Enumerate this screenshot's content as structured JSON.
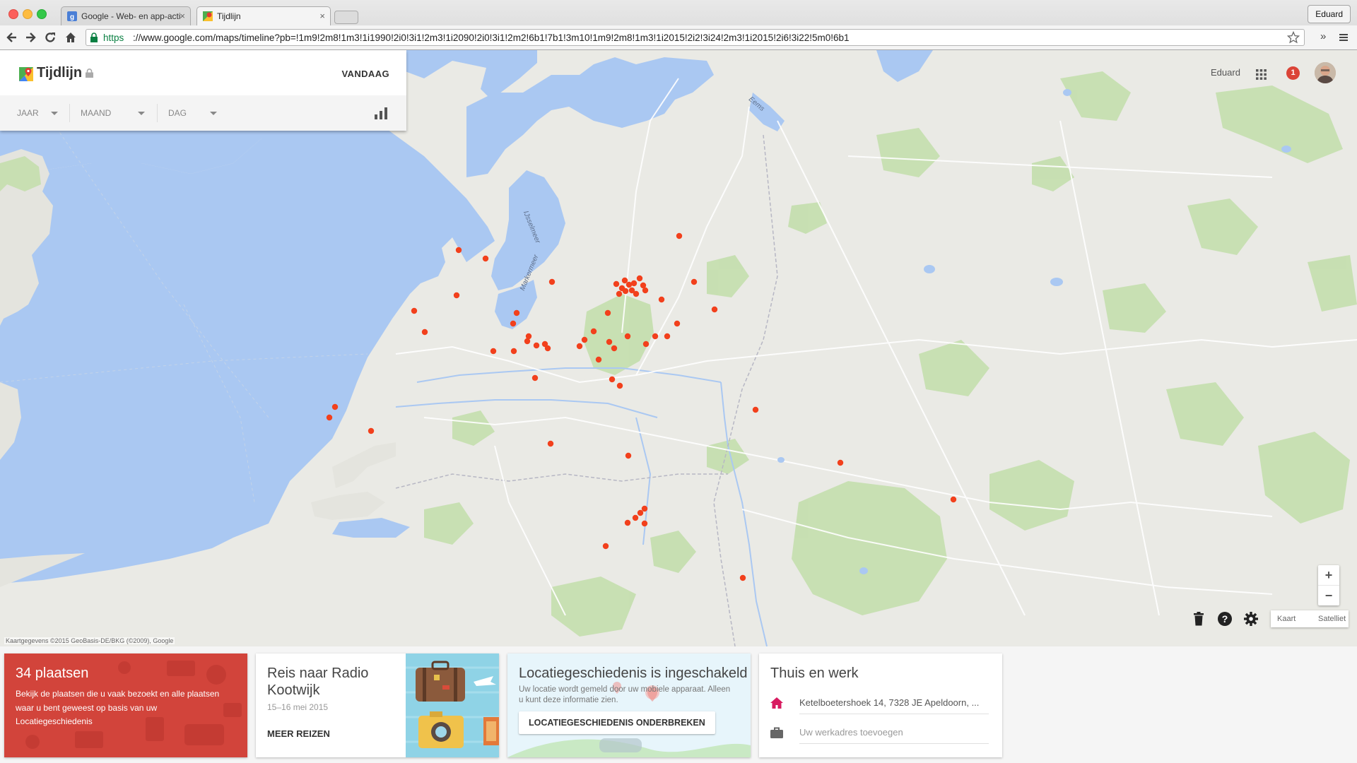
{
  "browser": {
    "tabs": [
      {
        "title": "Google - Web- en app-acti",
        "active": false
      },
      {
        "title": "Tijdlijn",
        "active": true
      }
    ],
    "profile_button": "Eduard",
    "url_scheme": "https",
    "url_rest": "://www.google.com/maps/timeline?pb=!1m9!2m8!1m3!1i1990!2i0!3i1!2m3!1i2090!2i0!3i1!2m2!6b1!7b1!3m10!1m9!2m8!1m3!1i2015!2i2!3i24!2m3!1i2015!2i6!3i22!5m0!6b1"
  },
  "timeline_panel": {
    "title": "Tijdlijn",
    "today_button": "VANDAAG",
    "filters": [
      "JAAR",
      "MAAND",
      "DAG"
    ]
  },
  "account": {
    "name": "Eduard",
    "notifications": "1"
  },
  "map": {
    "labels": {
      "ijsselmeer": "IJsselmeer",
      "markermeer": "Markermeer",
      "eems": "Eems"
    },
    "attribution": "Kaartgegevens ©2015 GeoBasis-DE/BKG (©2009), Google",
    "controls": {
      "zoom_in": "+",
      "zoom_out": "−",
      "map_type": "Kaart",
      "satellite_type": "Satelliet"
    },
    "visit_marker_color": "#f2401c"
  },
  "cards": {
    "places": {
      "title": "34 plaatsen",
      "description": "Bekijk de plaatsen die u vaak bezoekt en alle plaatsen waar u bent geweest op basis van uw Locatiegeschiedenis"
    },
    "trip": {
      "title": "Reis naar Radio Kootwijk",
      "date": "15–16 mei 2015",
      "action": "MEER REIZEN"
    },
    "location_history": {
      "title": "Locatiegeschiedenis is ingeschakeld",
      "description": "Uw locatie wordt gemeld door uw mobiele apparaat. Alleen u kunt deze informatie zien.",
      "action": "LOCATIEGESCHIEDENIS ONDERBREKEN"
    },
    "home_work": {
      "title": "Thuis en werk",
      "home_address": "Ketelboetershoek 14, 7328 JE Apeldoorn, ...",
      "work_placeholder": "Uw werkadres toevoegen"
    }
  },
  "colors": {
    "water": "#aac8f2",
    "places_card": "#d2443b",
    "home_icon": "#d81b60",
    "badge": "#db4437"
  }
}
